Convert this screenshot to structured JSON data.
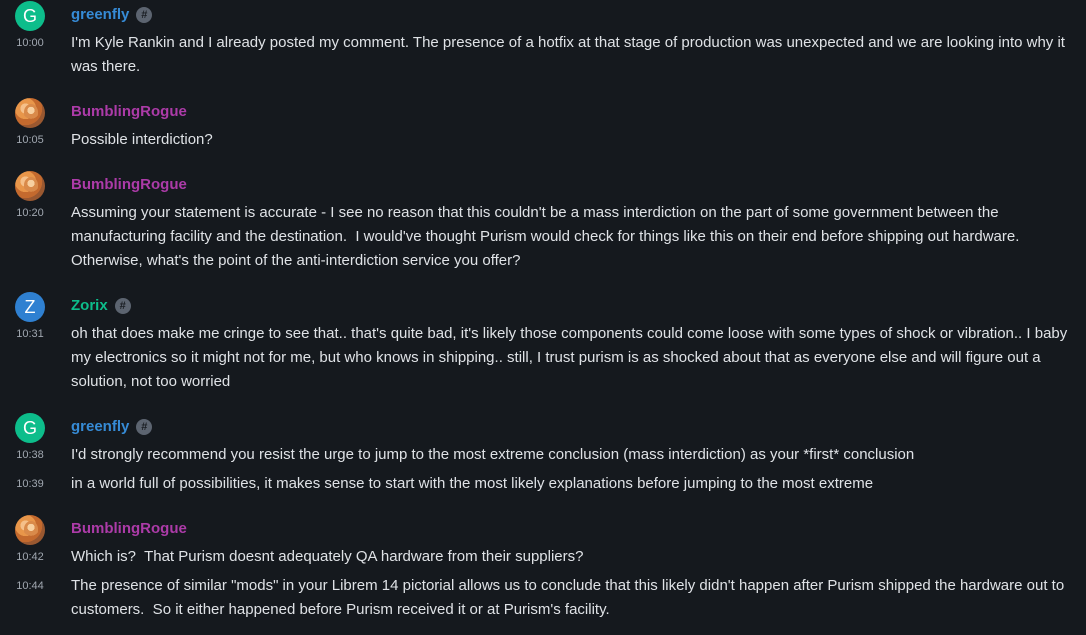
{
  "messages": [
    {
      "sender": "greenfly",
      "avatar_letter": "G",
      "has_badge": true,
      "badge_icon": "#",
      "entries": [
        {
          "time": "10:00",
          "text": "I'm Kyle Rankin and I already posted my comment. The presence of a hotfix at that stage of production was unexpected and we are looking into why it was there."
        }
      ]
    },
    {
      "sender": "BumblingRogue",
      "entries": [
        {
          "time": "10:05",
          "text": "Possible interdiction?"
        }
      ]
    },
    {
      "sender": "BumblingRogue",
      "entries": [
        {
          "time": "10:20",
          "text": "Assuming your statement is accurate - I see no reason that this couldn't be a mass interdiction on the part of some government between the manufacturing facility and the destination.  I would've thought Purism would check for things like this on their end before shipping out hardware.  Otherwise, what's the point of the anti-interdiction service you offer?"
        }
      ]
    },
    {
      "sender": "Zorix",
      "avatar_letter": "Z",
      "has_badge": true,
      "badge_icon": "#",
      "entries": [
        {
          "time": "10:31",
          "text": "oh that does make me cringe to see that.. that's quite bad, it's likely those components could come loose with some types of shock or vibration.. I baby my electronics so it might not for me, but who knows in shipping.. still, I trust purism is as shocked about that as everyone else and will figure out a solution, not too worried"
        }
      ]
    },
    {
      "sender": "greenfly",
      "avatar_letter": "G",
      "has_badge": true,
      "badge_icon": "#",
      "entries": [
        {
          "time": "10:38",
          "text": "I'd strongly recommend you resist the urge to jump to the most extreme conclusion (mass interdiction) as your *first* conclusion"
        },
        {
          "time": "10:39",
          "text": "in a world full of possibilities, it makes sense to start with the most likely explanations before jumping to the most extreme"
        }
      ]
    },
    {
      "sender": "BumblingRogue",
      "entries": [
        {
          "time": "10:42",
          "text": "Which is?  That Purism doesnt adequately QA hardware from their suppliers?"
        },
        {
          "time": "10:44",
          "text": "The presence of similar \"mods\" in your Librem 14 pictorial allows us to conclude that this likely didn't happen after Purism shipped the hardware out to customers.  So it either happened before Purism received it or at Purism's facility."
        }
      ]
    }
  ],
  "colors": {
    "background": "#15191e",
    "text": "#dfe2e6",
    "timestamp": "#a0a7b0",
    "greenfly_name": "#368bd6",
    "bumblingrogue_name": "#ac3ba8",
    "zorix_name": "#0dbd8b",
    "greenfly_avatar": "#0dbd8b",
    "zorix_avatar": "#2f80d1"
  }
}
